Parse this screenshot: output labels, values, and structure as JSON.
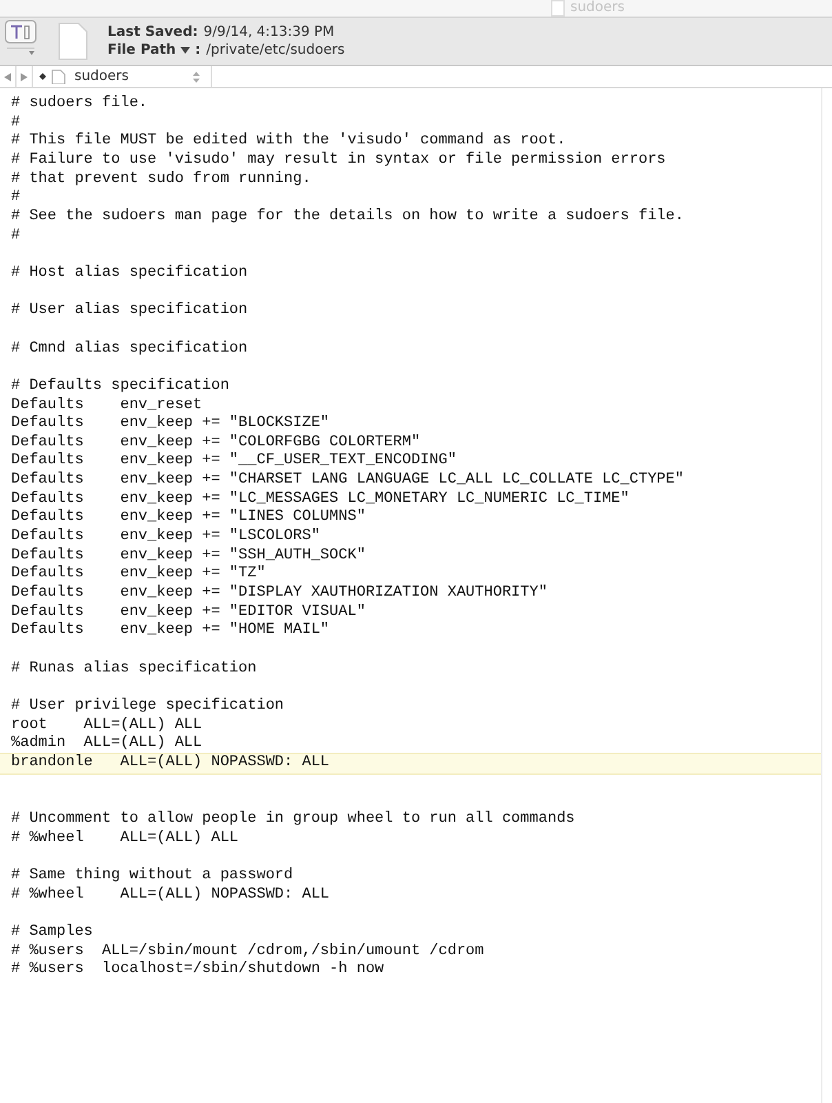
{
  "window": {
    "title": "sudoers"
  },
  "info": {
    "saved_label": "Last Saved:",
    "saved_value": "9/9/14, 4:13:39 PM",
    "path_label": "File Path",
    "path_separator": ":",
    "path_value": "/private/etc/sudoers"
  },
  "jump_bar": {
    "file_name": "sudoers"
  },
  "lines": [
    {
      "kind": "code",
      "text": "# sudoers file.",
      "highlighted": false
    },
    {
      "kind": "code",
      "text": "#",
      "highlighted": false
    },
    {
      "kind": "code",
      "text": "# This file MUST be edited with the 'visudo' command as root.",
      "highlighted": false
    },
    {
      "kind": "code",
      "text": "# Failure to use 'visudo' may result in syntax or file permission errors",
      "highlighted": false
    },
    {
      "kind": "code",
      "text": "# that prevent sudo from running.",
      "highlighted": false
    },
    {
      "kind": "code",
      "text": "#",
      "highlighted": false
    },
    {
      "kind": "code",
      "text": "# See the sudoers man page for the details on how to write a sudoers file.",
      "highlighted": false
    },
    {
      "kind": "code",
      "text": "#",
      "highlighted": false
    },
    {
      "kind": "blank"
    },
    {
      "kind": "code",
      "text": "# Host alias specification",
      "highlighted": false
    },
    {
      "kind": "blank"
    },
    {
      "kind": "code",
      "text": "# User alias specification",
      "highlighted": false
    },
    {
      "kind": "blank"
    },
    {
      "kind": "code",
      "text": "# Cmnd alias specification",
      "highlighted": false
    },
    {
      "kind": "blank"
    },
    {
      "kind": "code",
      "text": "# Defaults specification",
      "highlighted": false
    },
    {
      "kind": "code",
      "text": "Defaults    env_reset",
      "highlighted": false
    },
    {
      "kind": "code",
      "text": "Defaults    env_keep += \"BLOCKSIZE\"",
      "highlighted": false
    },
    {
      "kind": "code",
      "text": "Defaults    env_keep += \"COLORFGBG COLORTERM\"",
      "highlighted": false
    },
    {
      "kind": "code",
      "text": "Defaults    env_keep += \"__CF_USER_TEXT_ENCODING\"",
      "highlighted": false
    },
    {
      "kind": "code",
      "text": "Defaults    env_keep += \"CHARSET LANG LANGUAGE LC_ALL LC_COLLATE LC_CTYPE\"",
      "highlighted": false
    },
    {
      "kind": "code",
      "text": "Defaults    env_keep += \"LC_MESSAGES LC_MONETARY LC_NUMERIC LC_TIME\"",
      "highlighted": false
    },
    {
      "kind": "code",
      "text": "Defaults    env_keep += \"LINES COLUMNS\"",
      "highlighted": false
    },
    {
      "kind": "code",
      "text": "Defaults    env_keep += \"LSCOLORS\"",
      "highlighted": false
    },
    {
      "kind": "code",
      "text": "Defaults    env_keep += \"SSH_AUTH_SOCK\"",
      "highlighted": false
    },
    {
      "kind": "code",
      "text": "Defaults    env_keep += \"TZ\"",
      "highlighted": false
    },
    {
      "kind": "code",
      "text": "Defaults    env_keep += \"DISPLAY XAUTHORIZATION XAUTHORITY\"",
      "highlighted": false
    },
    {
      "kind": "code",
      "text": "Defaults    env_keep += \"EDITOR VISUAL\"",
      "highlighted": false
    },
    {
      "kind": "code",
      "text": "Defaults    env_keep += \"HOME MAIL\"",
      "highlighted": false
    },
    {
      "kind": "blank"
    },
    {
      "kind": "code",
      "text": "# Runas alias specification",
      "highlighted": false
    },
    {
      "kind": "blank"
    },
    {
      "kind": "code",
      "text": "# User privilege specification",
      "highlighted": false
    },
    {
      "kind": "code",
      "text": "root    ALL=(ALL) ALL",
      "highlighted": false
    },
    {
      "kind": "code",
      "text": "%admin  ALL=(ALL) ALL",
      "highlighted": false
    },
    {
      "kind": "code",
      "text": "brandonle   ALL=(ALL) NOPASSWD: ALL",
      "highlighted": true
    },
    {
      "kind": "blank"
    },
    {
      "kind": "blank"
    },
    {
      "kind": "code",
      "text": "# Uncomment to allow people in group wheel to run all commands",
      "highlighted": false
    },
    {
      "kind": "code",
      "text": "# %wheel    ALL=(ALL) ALL",
      "highlighted": false
    },
    {
      "kind": "blank"
    },
    {
      "kind": "code",
      "text": "# Same thing without a password",
      "highlighted": false
    },
    {
      "kind": "code",
      "text": "# %wheel    ALL=(ALL) NOPASSWD: ALL",
      "highlighted": false
    },
    {
      "kind": "blank"
    },
    {
      "kind": "code",
      "text": "# Samples",
      "highlighted": false
    },
    {
      "kind": "code",
      "text": "# %users  ALL=/sbin/mount /cdrom,/sbin/umount /cdrom",
      "highlighted": false
    },
    {
      "kind": "code",
      "text": "# %users  localhost=/sbin/shutdown -h now",
      "highlighted": false
    }
  ]
}
